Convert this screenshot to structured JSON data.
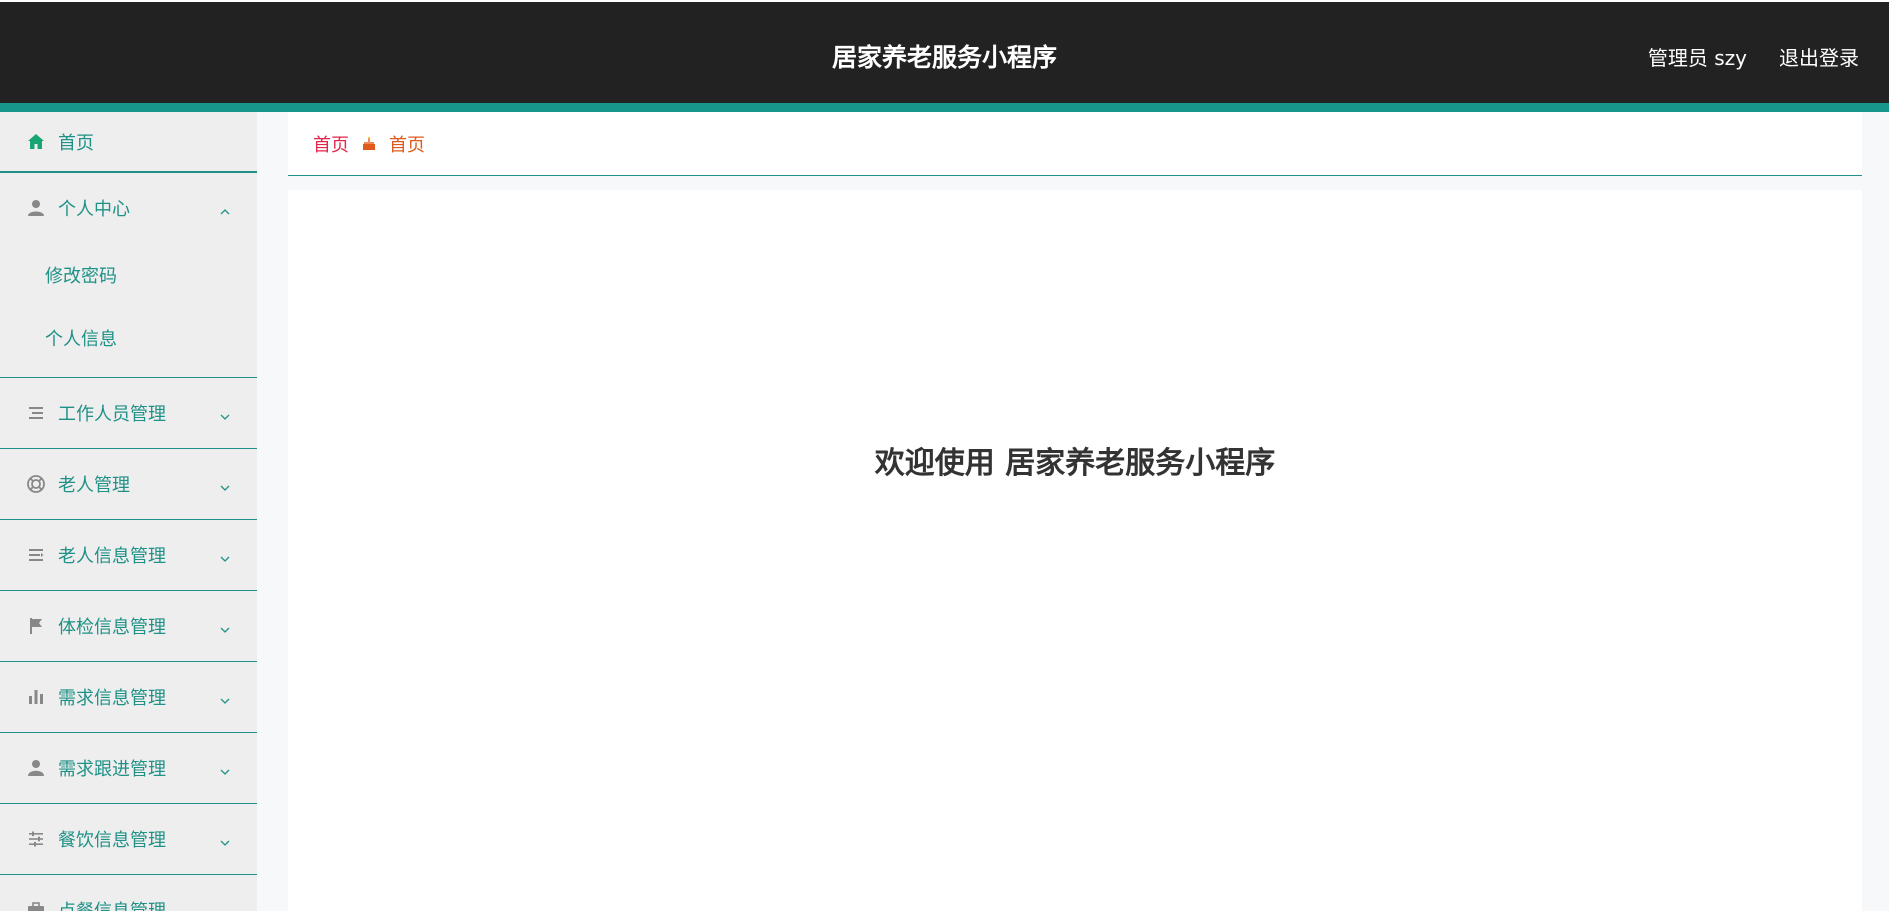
{
  "header": {
    "title": "居家养老服务小程序",
    "user": "管理员 szy",
    "logout": "退出登录"
  },
  "sidebar": {
    "home": "首页",
    "personal_center": {
      "label": "个人中心",
      "children": [
        "修改密码",
        "个人信息"
      ]
    },
    "items": [
      "工作人员管理",
      "老人管理",
      "老人信息管理",
      "体检信息管理",
      "需求信息管理",
      "需求跟进管理",
      "餐饮信息管理",
      "点餐信息管理"
    ]
  },
  "breadcrumb": {
    "home": "首页",
    "current": "首页"
  },
  "main": {
    "welcome": "欢迎使用 居家养老服务小程序"
  },
  "colors": {
    "header_bg": "#222222",
    "accent": "#17968c",
    "sidebar_bg": "#eeeeee",
    "breadcrumb_home": "#e0254c",
    "breadcrumb_current": "#e05a1c"
  },
  "icons": {
    "home": "home-icon",
    "personal_center": "user-icon",
    "staff": "list-icon",
    "elders": "lifebuoy-icon",
    "elder_info": "list-alt-icon",
    "checkup": "flag-icon",
    "demand": "bar-chart-icon",
    "followup": "person-icon",
    "catering": "sliders-icon",
    "orders": "briefcase-icon",
    "breadcrumb_sep": "cake-icon"
  }
}
